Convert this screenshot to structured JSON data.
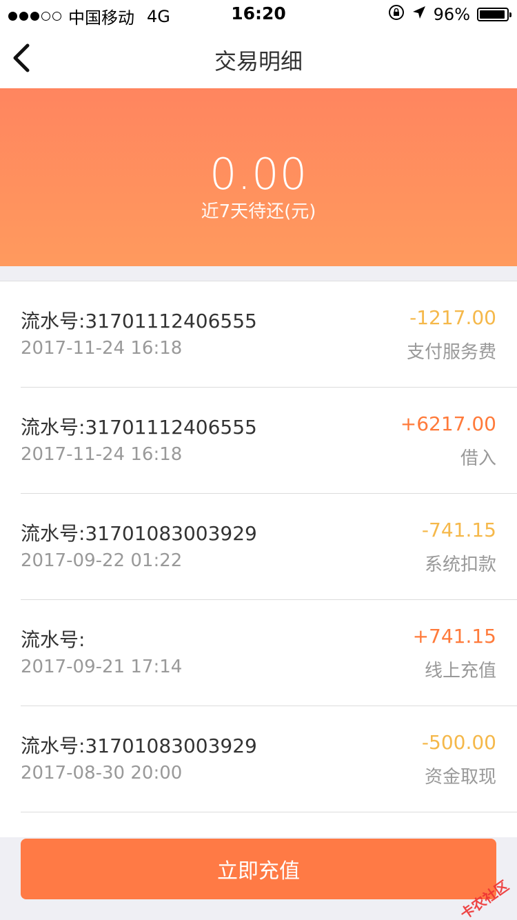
{
  "status_bar": {
    "carrier": "中国移动",
    "network": "4G",
    "time": "16:20",
    "battery": "96%",
    "battery_level": 0.96,
    "signal_filled": 3,
    "signal_total": 5
  },
  "nav": {
    "title": "交易明细",
    "back_icon": "chevron-left-icon"
  },
  "summary": {
    "amount": "0.00",
    "caption": "近7天待还(元)"
  },
  "transactions": [
    {
      "serial_label": "流水号:31701112406555",
      "date": "2017-11-24 16:18",
      "amount": "-1217.00",
      "type": "支付服务费",
      "sign": "neg"
    },
    {
      "serial_label": "流水号:31701112406555",
      "date": "2017-11-24 16:18",
      "amount": "+6217.00",
      "type": "借入",
      "sign": "pos"
    },
    {
      "serial_label": "流水号:31701083003929",
      "date": "2017-09-22 01:22",
      "amount": "-741.15",
      "type": "系统扣款",
      "sign": "neg"
    },
    {
      "serial_label": "流水号:",
      "date": "2017-09-21 17:14",
      "amount": "+741.15",
      "type": "线上充值",
      "sign": "pos"
    },
    {
      "serial_label": "流水号:31701083003929",
      "date": "2017-08-30 20:00",
      "amount": "-500.00",
      "type": "资金取现",
      "sign": "neg"
    }
  ],
  "bottom": {
    "button_label": "立即充值",
    "watermark": "卡农社区"
  },
  "colors": {
    "accent": "#ff7a45",
    "negative": "#f5b84a",
    "positive": "#ff7a3a"
  }
}
